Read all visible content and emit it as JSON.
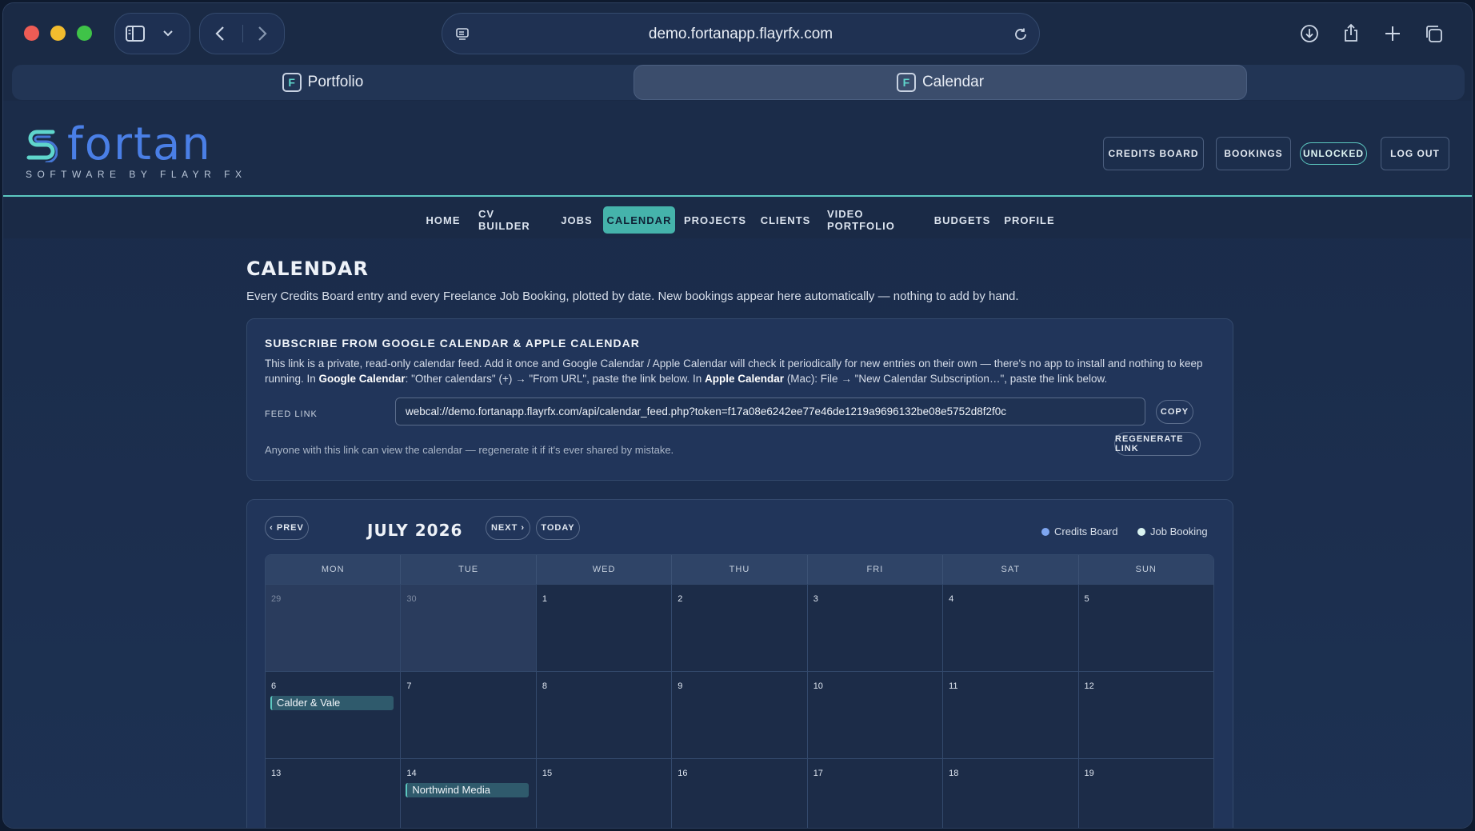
{
  "browser": {
    "url": "demo.fortanapp.flayrfx.com",
    "tabs": [
      {
        "label": "Portfolio",
        "favicon": "F"
      },
      {
        "label": "Calendar",
        "favicon": "F"
      }
    ]
  },
  "header": {
    "logo_word": "fortan",
    "logo_sub": "SOFTWARE BY FLAYR FX",
    "buttons": {
      "credits": "CREDITS BOARD",
      "bookings": "BOOKINGS",
      "unlocked": "UNLOCKED",
      "logout": "LOG OUT"
    }
  },
  "nav": {
    "items": [
      "HOME",
      "CV BUILDER",
      "JOBS",
      "CALENDAR",
      "PROJECTS",
      "CLIENTS",
      "VIDEO PORTFOLIO",
      "BUDGETS",
      "PROFILE"
    ],
    "active": "CALENDAR"
  },
  "page": {
    "title": "CALENDAR",
    "subtitle": "Every Credits Board entry and every Freelance Job Booking, plotted by date. New bookings appear here automatically — nothing to add by hand."
  },
  "subscribe": {
    "title": "SUBSCRIBE FROM GOOGLE CALENDAR & APPLE CALENDAR",
    "desc_1": "This link is a private, read-only calendar feed. Add it once and Google Calendar / Apple Calendar will check it periodically for new entries on their own — there's no app to install and nothing to keep running. In ",
    "desc_google": "Google Calendar",
    "desc_2": ": \"Other calendars\" (+) → \"From URL\", paste the link below. In ",
    "desc_apple": "Apple Calendar",
    "desc_3": " (Mac): File → \"New Calendar Subscription…\", paste the link below.",
    "feed_label": "FEED LINK",
    "feed_value": "webcal://demo.fortanapp.flayrfx.com/api/calendar_feed.php?token=f17a08e6242ee77e46de1219a9696132be08e5752d8f2f0c",
    "copy_label": "COPY",
    "warning": "Anyone with this link can view the calendar — regenerate it if it's ever shared by mistake.",
    "regen_label": "REGENERATE LINK"
  },
  "calendar": {
    "prev_label": "‹ PREV",
    "next_label": "NEXT ›",
    "today_label": "TODAY",
    "month": "JULY 2026",
    "legend": [
      {
        "label": "Credits Board",
        "color": "#7ea6f0"
      },
      {
        "label": "Job Booking",
        "color": "#d9f3f1"
      }
    ],
    "weekdays": [
      "MON",
      "TUE",
      "WED",
      "THU",
      "FRI",
      "SAT",
      "SUN"
    ],
    "weeks": [
      [
        {
          "d": "29",
          "other": true
        },
        {
          "d": "30",
          "other": true
        },
        {
          "d": "1"
        },
        {
          "d": "2"
        },
        {
          "d": "3"
        },
        {
          "d": "4"
        },
        {
          "d": "5"
        }
      ],
      [
        {
          "d": "6",
          "event": "Calder & Vale"
        },
        {
          "d": "7"
        },
        {
          "d": "8"
        },
        {
          "d": "9"
        },
        {
          "d": "10"
        },
        {
          "d": "11"
        },
        {
          "d": "12"
        }
      ],
      [
        {
          "d": "13"
        },
        {
          "d": "14",
          "event": "Northwind Media"
        },
        {
          "d": "15"
        },
        {
          "d": "16"
        },
        {
          "d": "17"
        },
        {
          "d": "18"
        },
        {
          "d": "19"
        }
      ]
    ]
  },
  "colors": {
    "accent": "#45b3ab",
    "brand": "#4a7fe6",
    "background": "#1b2d4b"
  }
}
